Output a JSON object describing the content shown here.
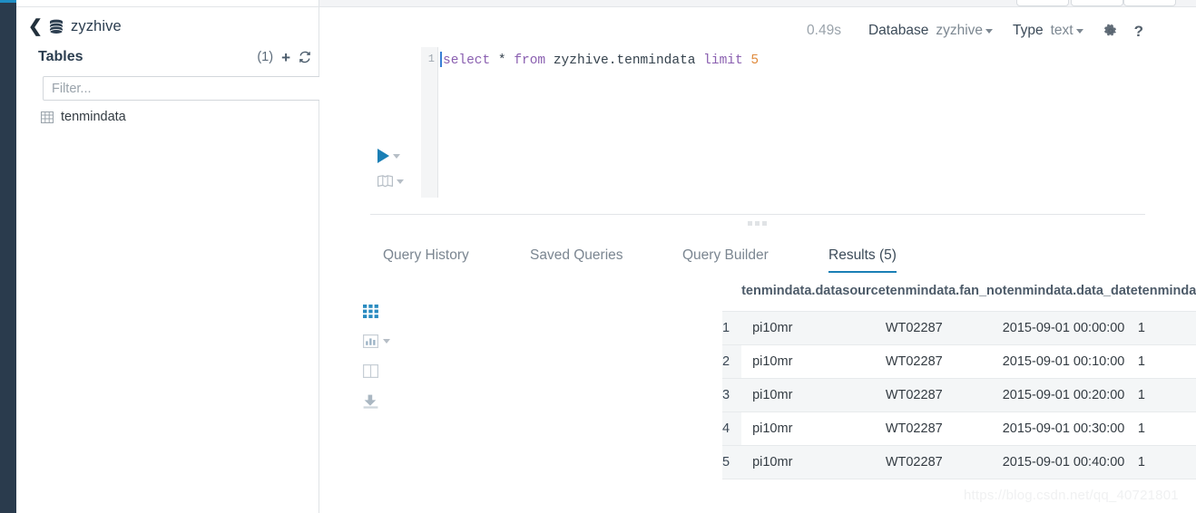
{
  "rail": {
    "accent_color": "#1f8ec4",
    "background_color": "#2a3b4d"
  },
  "sidebar": {
    "back_label": "‹",
    "database_name": "zyzhive",
    "database_icon": "database-icon",
    "tables_label": "Tables",
    "tables_count": "(1)",
    "add_label": "+",
    "refresh_icon": "refresh-icon",
    "filter_placeholder": "Filter...",
    "filter_value": "",
    "tables": [
      {
        "name": "tenmindata",
        "icon": "table-grid-icon"
      }
    ]
  },
  "toolbar": {
    "elapsed_time": "0.49s",
    "database_label": "Database",
    "database_value": "zyzhive",
    "type_label": "Type",
    "type_value": "text",
    "settings_icon": "gear-icon",
    "help_label": "?"
  },
  "editor": {
    "line_number": "1",
    "run_icon": "play-icon",
    "explain_icon": "book-icon",
    "query_tokens": [
      {
        "text": "select",
        "kind": "keyword"
      },
      {
        "text": " * ",
        "kind": "plain"
      },
      {
        "text": "from",
        "kind": "keyword"
      },
      {
        "text": " zyzhive.tenmindata ",
        "kind": "identifier"
      },
      {
        "text": "limit",
        "kind": "keyword"
      },
      {
        "text": " ",
        "kind": "plain"
      },
      {
        "text": "5",
        "kind": "number"
      }
    ],
    "query_text": "select * from zyzhive.tenmindata limit 5"
  },
  "tabs": [
    {
      "label": "Query History",
      "active": false
    },
    {
      "label": "Saved Queries",
      "active": false
    },
    {
      "label": "Query Builder",
      "active": false
    },
    {
      "label": "Results (5)",
      "active": true
    }
  ],
  "result_tools": [
    {
      "name": "grid-view-icon",
      "active": true
    },
    {
      "name": "chart-view-icon",
      "active": false
    },
    {
      "name": "columns-view-icon",
      "active": false
    },
    {
      "name": "download-icon",
      "active": false
    }
  ],
  "results": {
    "columns": [
      "tenmindata.datasource",
      "tenmindata.fan_no",
      "tenmindata.data_date",
      "tenmindata.fan_status"
    ],
    "rows": [
      {
        "index": "1",
        "datasource": "pi10mr",
        "fan_no": "WT02287",
        "data_date": "2015-09-01 00:00:00",
        "fan_status": "1"
      },
      {
        "index": "2",
        "datasource": "pi10mr",
        "fan_no": "WT02287",
        "data_date": "2015-09-01 00:10:00",
        "fan_status": "1"
      },
      {
        "index": "3",
        "datasource": "pi10mr",
        "fan_no": "WT02287",
        "data_date": "2015-09-01 00:20:00",
        "fan_status": "1"
      },
      {
        "index": "4",
        "datasource": "pi10mr",
        "fan_no": "WT02287",
        "data_date": "2015-09-01 00:30:00",
        "fan_status": "1"
      },
      {
        "index": "5",
        "datasource": "pi10mr",
        "fan_no": "WT02287",
        "data_date": "2015-09-01 00:40:00",
        "fan_status": "1"
      }
    ]
  },
  "watermark": "https://blog.csdn.net/qq_40721801",
  "colors": {
    "accent_blue": "#1a7fb5",
    "rail_dark": "#2a3b4d",
    "row_alt": "#f4f6f7",
    "keyword_purple": "#8a5fb0",
    "number_orange": "#e08a3c"
  }
}
